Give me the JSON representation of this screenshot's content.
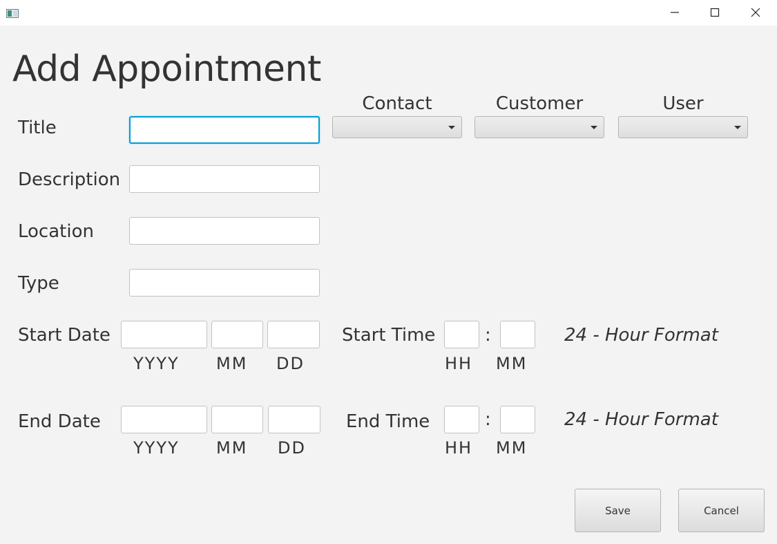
{
  "window": {
    "controls": {
      "minimize_icon": "minimize-icon",
      "maximize_icon": "maximize-icon",
      "close_icon": "close-icon"
    }
  },
  "form": {
    "heading": "Add Appointment",
    "fields": {
      "title": {
        "label": "Title",
        "value": ""
      },
      "description": {
        "label": "Description",
        "value": ""
      },
      "location": {
        "label": "Location",
        "value": ""
      },
      "type": {
        "label": "Type",
        "value": ""
      }
    },
    "selectors": {
      "contact": {
        "label": "Contact",
        "value": ""
      },
      "customer": {
        "label": "Customer",
        "value": ""
      },
      "user": {
        "label": "User",
        "value": ""
      }
    },
    "start": {
      "date_label": "Start Date",
      "time_label": "Start Time",
      "year": "",
      "month": "",
      "day": "",
      "hour": "",
      "minute": "",
      "year_hint": "YYYY",
      "month_hint": "MM",
      "day_hint": "DD",
      "hour_hint": "HH",
      "minute_hint": "MM",
      "separator": ":",
      "format_note": "24 - Hour Format"
    },
    "end": {
      "date_label": "End Date",
      "time_label": "End Time",
      "year": "",
      "month": "",
      "day": "",
      "hour": "",
      "minute": "",
      "year_hint": "YYYY",
      "month_hint": "MM",
      "day_hint": "DD",
      "hour_hint": "HH",
      "minute_hint": "MM",
      "separator": ":",
      "format_note": "24 - Hour Format"
    },
    "buttons": {
      "save": "Save",
      "cancel": "Cancel"
    }
  },
  "colors": {
    "focus_accent": "#039ed3",
    "background": "#f3f3f3"
  }
}
